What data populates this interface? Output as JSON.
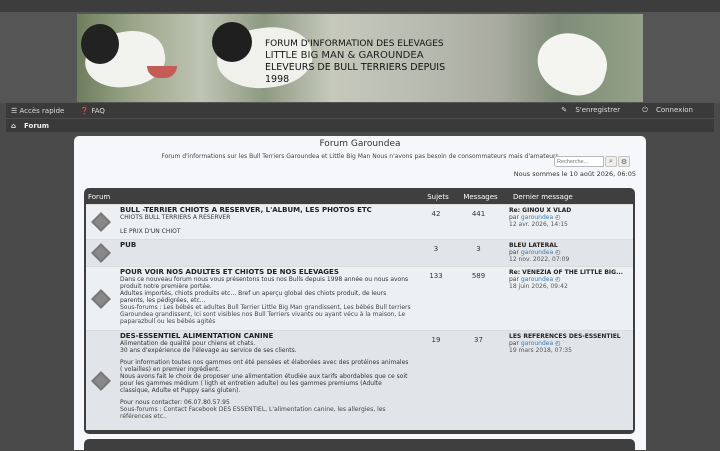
{
  "banner": {
    "line1": "FORUM D'INFORMATION DES ELEVAGES",
    "line2": "LITTLE BIG MAN & GAROUNDEA",
    "line3": "ELEVEURS DE BULL TERRIERS DEPUIS 1998"
  },
  "nav": {
    "quick": "Accès rapide",
    "faq": "FAQ",
    "register": "S'enregistrer",
    "login": "Connexion",
    "breadcrumb": "Forum"
  },
  "site": {
    "title": "Forum Garoundea",
    "desc": "Forum d'informations sur les Bull Terriers Garoundea et Little Big Man Nous n'avons pas besoin de consommateurs mais d'amateurs",
    "search_placeholder": "Recherche...",
    "date": "Nous sommes le 10 août 2026, 06:05"
  },
  "table": {
    "col_forum": "Forum",
    "col_topics": "Sujets",
    "col_posts": "Messages",
    "col_last": "Dernier message",
    "rows": [
      {
        "title": "BULL -TERRIER CHIOTS A RESERVER, L'ALBUM, LES PHOTOS ETC",
        "desc": "CHIOTS BULL TERRIERS A RESERVER",
        "desc2": "LE PRIX D'UN CHIOT",
        "topics": "42",
        "posts": "441",
        "last_title": "Re: GINOU X VLAD",
        "last_by": "par",
        "last_user": "garoundea",
        "last_date": "12 avr. 2026, 14:15"
      },
      {
        "title": "PUB",
        "desc": "",
        "desc2": "",
        "topics": "3",
        "posts": "3",
        "last_title": "BLEU LATERAL",
        "last_by": "par",
        "last_user": "garoundea",
        "last_date": "12 nov. 2022, 07:09"
      },
      {
        "title": "POUR VOIR NOS ADULTES ET CHIOTS DE NOS ELEVAGES",
        "desc": "Dans ce nouveau forum nous vous présentons tous nos Bulls depuis 1998 année ou nous avons produit notre première portée.",
        "desc2": "Adultes importés, chiots produits etc... Bref un aperçu global des chiots produit, de leurs parents, les pédigrées, etc...",
        "sub": "Sous-forums : Les bébés et adultes Bull Terrier Little Big Man grandissent, Les bébés Bull terriers Garoundea grandissent, Ici sont visibles nos Bull Terriers vivants ou ayant vécu à la maison, Le paparazbull ou les bébés agités",
        "topics": "133",
        "posts": "589",
        "last_title": "Re: VENEZIA OF THE LITTLE BIG...",
        "last_by": "par",
        "last_user": "garoundea",
        "last_date": "18 juin 2026, 09:42"
      },
      {
        "title": "DES-ESSENTIEL ALIMENTATION CANINE",
        "desc": "Alimentation de qualité pour chiens et chats.",
        "desc2": "30 ans d'expérience de l'élevage au service de ses clients.",
        "desc3": "Pour information toutes nos gammes ont été pensées et élaborées avec des protéines animales ( volailles) en premier ingrédient.",
        "desc4": "Nous avons fait le choix de proposer une alimentation étudiée aux tarifs abordables que ce soit pour les gammes médium ( ligth et entretien adulte) ou les gammes premiums (Adulte classique, Adulte et Puppy sans gluten).",
        "desc5": "Pour nous contacter: 06.07.80.57.95",
        "sub": "Sous-forums : Contact Facebook DES ESSENTIEL, L'alimentation canine, les allergies, les références etc..",
        "topics": "19",
        "posts": "37",
        "last_title": "LES REFERENCES DES-ESSENTIEL",
        "last_by": "par",
        "last_user": "garoundea",
        "last_date": "19 mars 2018, 07:35"
      }
    ]
  }
}
